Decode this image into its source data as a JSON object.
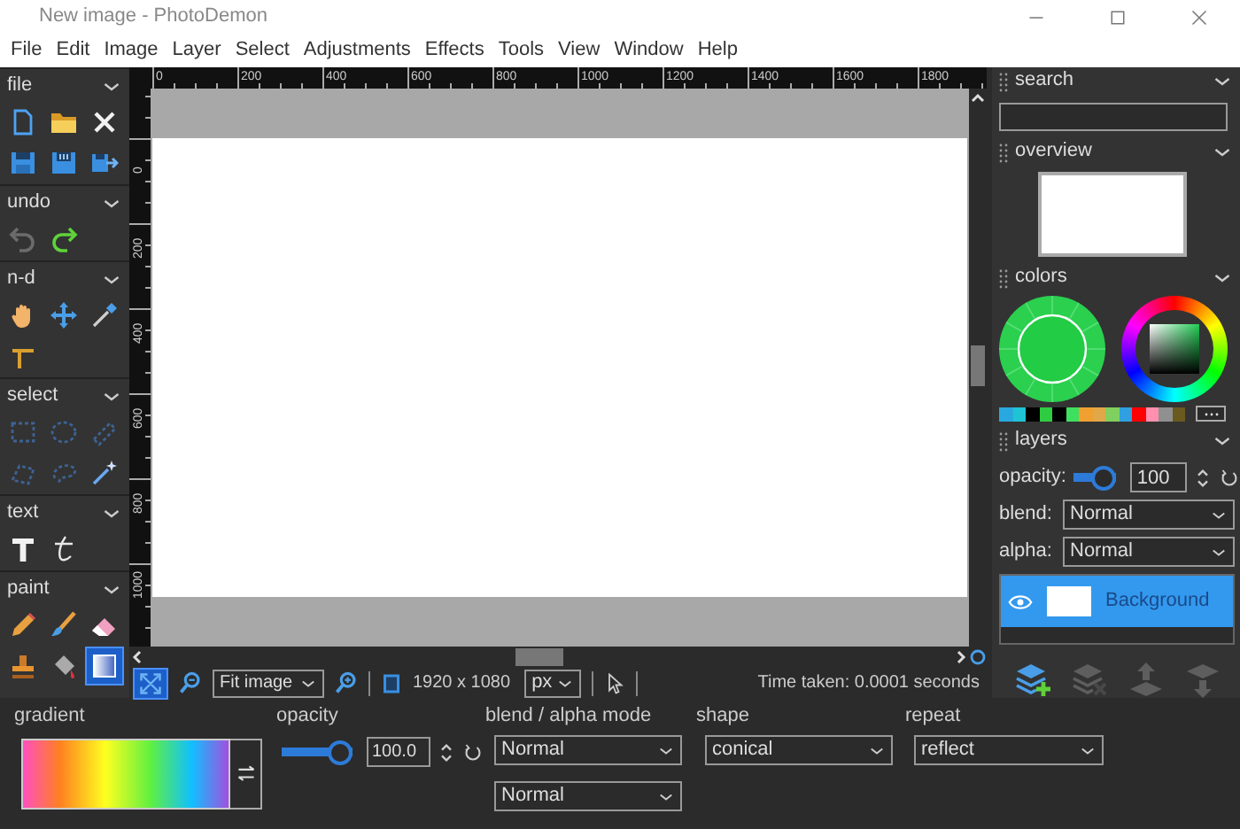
{
  "window": {
    "title": "New image - PhotoDemon"
  },
  "menu": [
    "File",
    "Edit",
    "Image",
    "Layer",
    "Select",
    "Adjustments",
    "Effects",
    "Tools",
    "View",
    "Window",
    "Help"
  ],
  "toolbox": [
    {
      "title": "file",
      "tools": [
        {
          "selected": false,
          "disabled": false
        },
        {
          "selected": false,
          "disabled": false
        },
        {
          "selected": false,
          "disabled": false
        },
        {
          "selected": false,
          "disabled": false
        },
        {
          "selected": false,
          "disabled": false
        },
        {
          "selected": false,
          "disabled": false
        }
      ]
    },
    {
      "title": "undo",
      "tools": [
        {
          "selected": false,
          "disabled": true
        },
        {
          "selected": false,
          "disabled": false
        }
      ]
    },
    {
      "title": "n-d",
      "tools": [
        {
          "selected": false,
          "disabled": false
        },
        {
          "selected": false,
          "disabled": false
        },
        {
          "selected": false,
          "disabled": false
        },
        {
          "selected": false,
          "disabled": false
        }
      ]
    },
    {
      "title": "select",
      "tools": [
        {
          "selected": false,
          "disabled": false
        },
        {
          "selected": false,
          "disabled": false
        },
        {
          "selected": false,
          "disabled": false
        },
        {
          "selected": false,
          "disabled": false
        },
        {
          "selected": false,
          "disabled": false
        },
        {
          "selected": false,
          "disabled": false
        }
      ]
    },
    {
      "title": "text",
      "tools": [
        {
          "selected": false,
          "disabled": false
        },
        {
          "selected": false,
          "disabled": false
        }
      ]
    },
    {
      "title": "paint",
      "tools": [
        {
          "selected": false,
          "disabled": false
        },
        {
          "selected": false,
          "disabled": false
        },
        {
          "selected": false,
          "disabled": false
        },
        {
          "selected": false,
          "disabled": false
        },
        {
          "selected": false,
          "disabled": false
        },
        {
          "selected": true,
          "disabled": false
        }
      ]
    }
  ],
  "ruler": {
    "top_labels": [
      "0",
      "200",
      "400",
      "600",
      "800",
      "1000",
      "1200",
      "1400",
      "1600",
      "1800"
    ],
    "left_labels": [
      "0",
      "200",
      "400",
      "600",
      "800",
      "1000"
    ]
  },
  "status_bar": {
    "fit_button": {
      "selected": true
    },
    "zoom": "Fit image",
    "size": "1920 x 1080",
    "unit": "px",
    "time": "Time taken: 0.0001 seconds"
  },
  "tool_options": {
    "gradient": {
      "label": "gradient"
    },
    "opacity": {
      "label": "opacity",
      "level": 1,
      "value": "100.0"
    },
    "blend": {
      "label": "blend / alpha mode",
      "values": [
        "Normal",
        "Normal"
      ]
    },
    "shape": {
      "label": "shape",
      "value": "conical"
    },
    "repeat": {
      "label": "repeat",
      "value": "reflect"
    }
  },
  "panels": {
    "search": {
      "title": "search"
    },
    "overview": {
      "title": "overview"
    },
    "colors": {
      "title": "colors",
      "palette": [
        {
          "color": "#29a8e0"
        },
        {
          "color": "#1ec4d4"
        },
        {
          "color": "#000000"
        },
        {
          "color": "#2ecc40"
        },
        {
          "color": "#000000"
        },
        {
          "color": "#3ee060"
        },
        {
          "color": "#f0a030"
        },
        {
          "color": "#e0a848"
        },
        {
          "color": "#80d060"
        },
        {
          "color": "#30a0e0"
        },
        {
          "color": "#ff0000"
        },
        {
          "color": "#ff90b0"
        },
        {
          "color": "#909090"
        },
        {
          "color": "#6a5a20"
        }
      ]
    },
    "layers": {
      "title": "layers",
      "opacity_label": "opacity:",
      "level": 1,
      "opacity_value": "100",
      "blend_label": "blend:",
      "blend": "Normal",
      "alpha_label": "alpha:",
      "alpha": "Normal",
      "items": [
        {
          "name": "Background",
          "selected": true,
          "visible": true
        }
      ],
      "actions": [
        {
          "disabled": false
        },
        {
          "disabled": true
        },
        {
          "disabled": true
        },
        {
          "disabled": true
        }
      ]
    }
  }
}
